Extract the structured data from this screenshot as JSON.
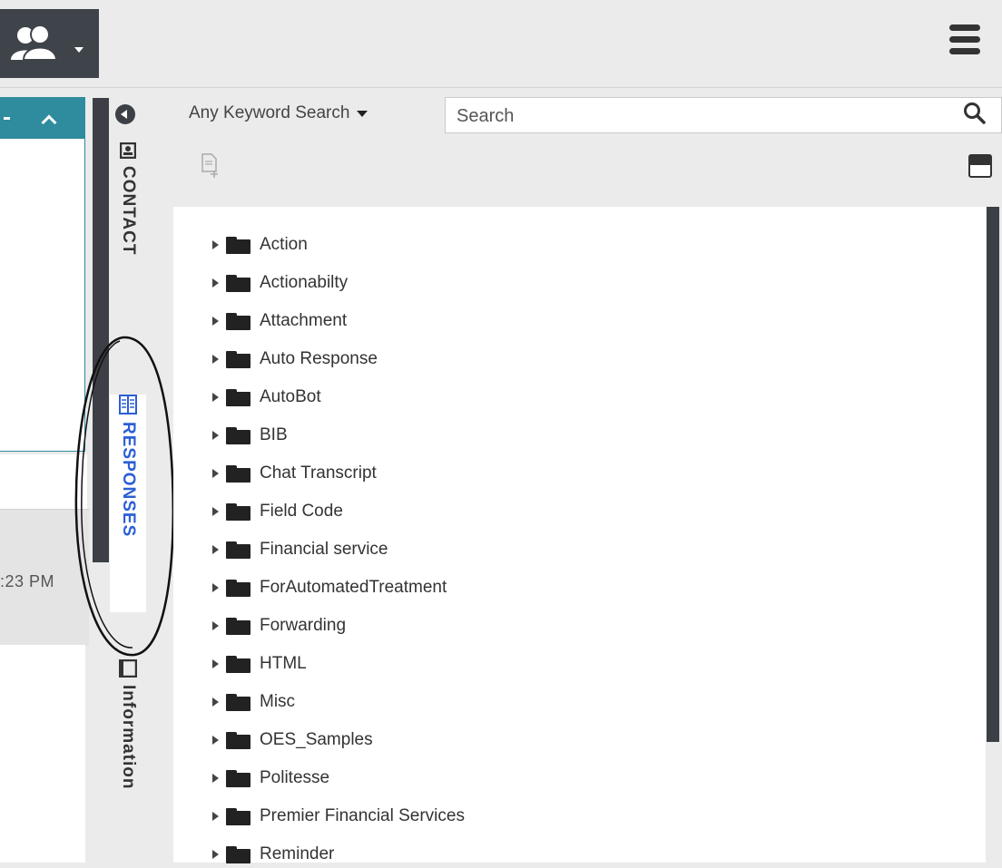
{
  "header": {
    "agent_icon": "agent-user-icon",
    "menu_icon": "hamburger-menu-icon"
  },
  "left_pane": {
    "timestamp": ":23 PM"
  },
  "side_tabs": {
    "contact": "CONTACT",
    "responses": "RESPONSES",
    "information": "Information",
    "active_tab": "responses",
    "active_color": "#2b5fd6"
  },
  "responses": {
    "search_type": "Any Keyword Search",
    "search_placeholder": "Search",
    "search_value": "",
    "folders": [
      "Action",
      "Actionabilty",
      "Attachment",
      "Auto Response",
      "AutoBot",
      "BIB",
      "Chat Transcript",
      "Field Code",
      "Financial service",
      "ForAutomatedTreatment",
      "Forwarding",
      "HTML",
      "Misc",
      "OES_Samples",
      "Politesse",
      "Premier Financial Services",
      "Reminder"
    ]
  },
  "colors": {
    "accent_teal": "#2e8c9e",
    "dark_chrome": "#3c4046"
  }
}
